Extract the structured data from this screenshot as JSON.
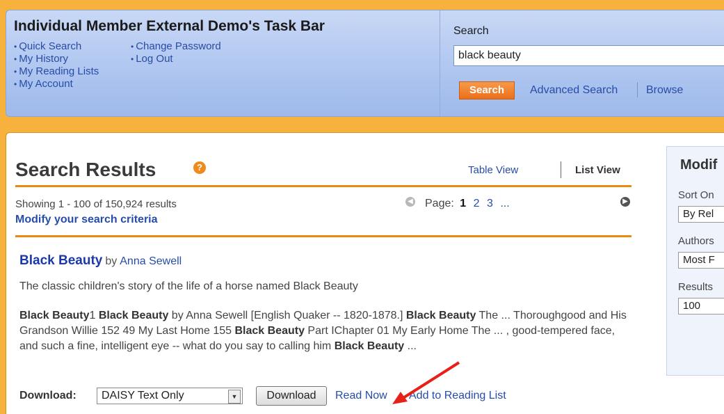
{
  "taskbar": {
    "title": "Individual Member External Demo's Task Bar",
    "left_links": [
      "Quick Search",
      "My History",
      "My Reading Lists",
      "My Account"
    ],
    "right_links": [
      "Change Password",
      "Log Out"
    ]
  },
  "search": {
    "label": "Search",
    "value": "black beauty",
    "button": "Search",
    "advanced": "Advanced Search",
    "browse": "Browse"
  },
  "results": {
    "title": "Search Results",
    "help_icon": "?",
    "table_view": "Table View",
    "list_view": "List View",
    "showing": "Showing 1 - 100 of 150,924 results",
    "modify": "Modify your search criteria",
    "page_label": "Page:",
    "current_page": "1",
    "pages": [
      "2",
      "3",
      "..."
    ]
  },
  "result_item": {
    "title": "Black Beauty",
    "by": "by",
    "author": "Anna Sewell",
    "description": "The classic children's story of the life of a horse named Black Beauty",
    "excerpt": [
      {
        "b": "Black Beauty"
      },
      {
        "t": "1 "
      },
      {
        "b": "Black Beauty"
      },
      {
        "t": " by Anna Sewell [English Quaker -- 1820-1878.] "
      },
      {
        "b": "Black Beauty"
      },
      {
        "t": " The ... Thoroughgood and His Grandson Willie 152 49 My Last Home 155 "
      },
      {
        "b": "Black Beauty"
      },
      {
        "t": " Part IChapter 01 My Early Home The ... , good-tempered face, and such a fine, intelligent eye -- what do you say to calling him "
      },
      {
        "b": "Black Beauty"
      },
      {
        "t": " ..."
      }
    ],
    "download_label": "Download:",
    "download_format": "DAISY Text Only",
    "download_button": "Download",
    "read_now": "Read Now",
    "separator": "•",
    "add_to_list": "Add to Reading List"
  },
  "sidebar": {
    "title": "Modif",
    "sort_label": "Sort On",
    "sort_value": "By Rel",
    "authors_label": "Authors",
    "authors_value": "Most F",
    "results_label": "Results",
    "results_value": "100"
  },
  "colors": {
    "accent_orange": "#f6b23c",
    "link_blue": "#274ca8",
    "annotation_arrow": "#e8201a"
  }
}
